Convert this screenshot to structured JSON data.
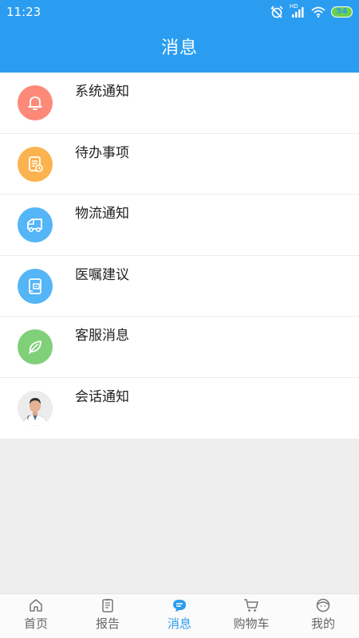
{
  "status_bar": {
    "time": "11:23",
    "network_label": "HD",
    "battery": "54"
  },
  "header": {
    "title": "消息"
  },
  "messages": [
    {
      "label": "系统通知",
      "icon": "bell-icon",
      "color": "#fd8a79"
    },
    {
      "label": "待办事项",
      "icon": "document-clock-icon",
      "color": "#fcb24f"
    },
    {
      "label": "物流通知",
      "icon": "truck-icon",
      "color": "#54b5f7"
    },
    {
      "label": "医嘱建议",
      "icon": "medical-device-icon",
      "color": "#54b5f7"
    },
    {
      "label": "客服消息",
      "icon": "leaf-icon",
      "color": "#80d07a"
    },
    {
      "label": "会话通知",
      "icon": "doctor-avatar",
      "color": "#e8e8e8"
    }
  ],
  "tabs": [
    {
      "label": "首页",
      "icon": "home-icon"
    },
    {
      "label": "报告",
      "icon": "report-icon"
    },
    {
      "label": "消息",
      "icon": "message-icon",
      "active": true
    },
    {
      "label": "购物车",
      "icon": "cart-icon"
    },
    {
      "label": "我的",
      "icon": "user-icon"
    }
  ]
}
